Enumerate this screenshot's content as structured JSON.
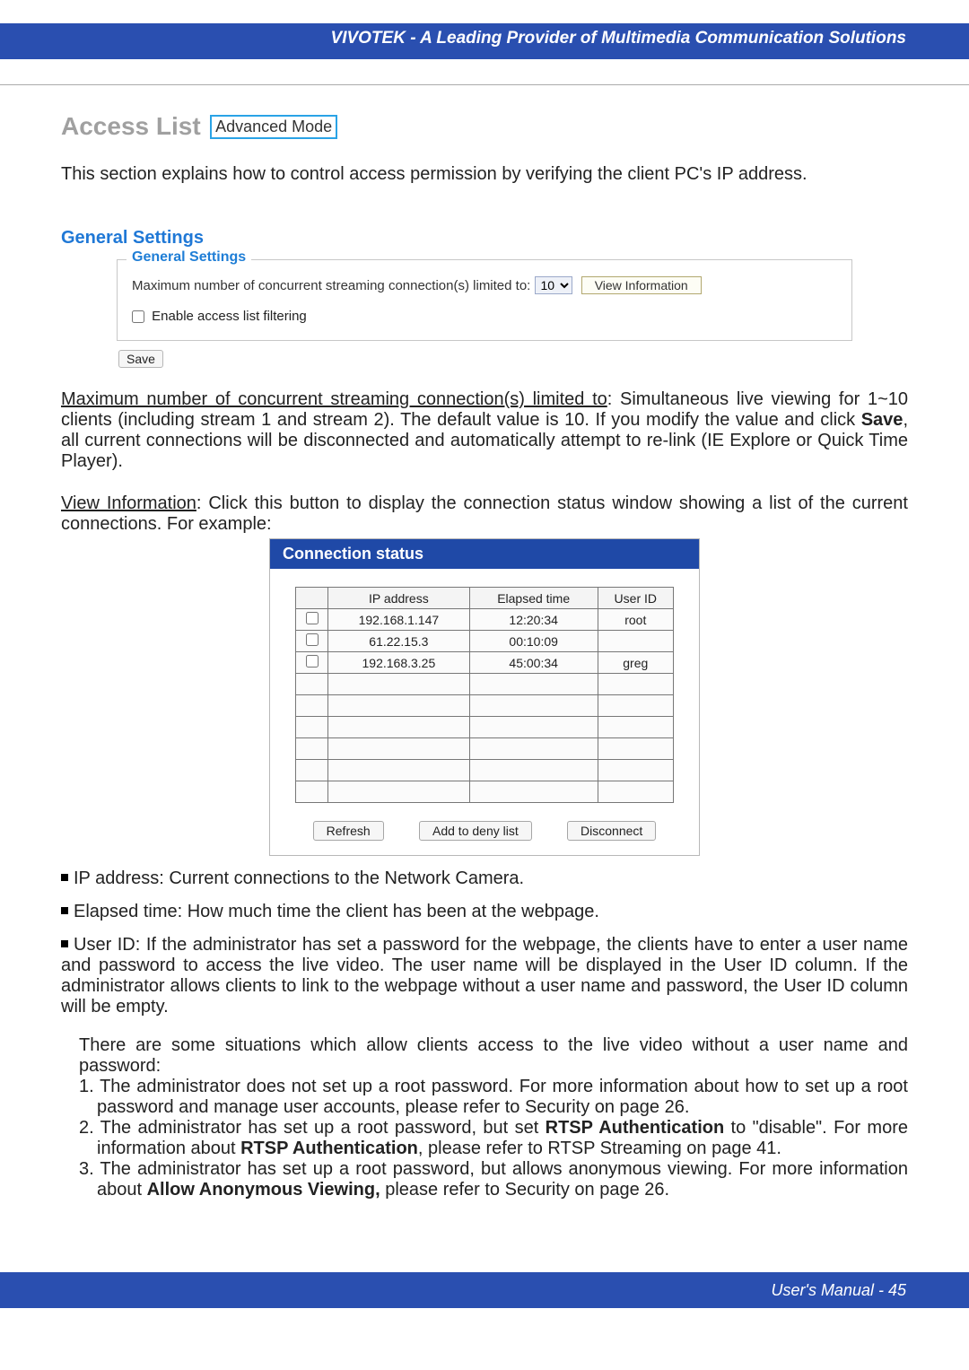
{
  "header": {
    "title": "VIVOTEK - A Leading Provider of Multimedia Communication Solutions"
  },
  "title": {
    "main": "Access List",
    "badge": "Advanced Mode"
  },
  "intro": "This section explains how to control access permission by verifying the client PC's IP address.",
  "gs_heading": "General Settings",
  "general_settings": {
    "legend": "General Settings",
    "max_label": "Maximum number of concurrent streaming connection(s) limited to:",
    "max_value": "10",
    "view_info_btn": "View Information",
    "enable_filter_label": "Enable access list filtering",
    "save_btn": "Save"
  },
  "para_max": {
    "lead": "Maximum number of concurrent streaming connection(s) limited to",
    "rest_a": ": Simultaneous live viewing for 1~10 clients (including stream 1 and stream 2). The default value is 10. If you modify the value and click ",
    "save_word": "Save",
    "rest_b": ", all current connections will be disconnected and automatically attempt to re-link (IE Explore or Quick Time Player)."
  },
  "para_view": {
    "lead": "View Information",
    "rest": ": Click this button to display the connection status window showing a list of the current connections. For example:"
  },
  "conn_status": {
    "title": "Connection status",
    "headers": [
      "",
      "IP address",
      "Elapsed time",
      "User ID"
    ],
    "rows": [
      {
        "ip": "192.168.1.147",
        "time": "12:20:34",
        "user": "root"
      },
      {
        "ip": "61.22.15.3",
        "time": "00:10:09",
        "user": ""
      },
      {
        "ip": "192.168.3.25",
        "time": "45:00:34",
        "user": "greg"
      }
    ],
    "empty_rows": 6,
    "buttons": {
      "refresh": "Refresh",
      "add": "Add to deny list",
      "disconnect": "Disconnect"
    }
  },
  "bullets": {
    "ip": "IP address: Current connections to the Network Camera.",
    "elapsed": "Elapsed time: How much time the client has been at the webpage.",
    "userid": "User ID: If the administrator has set a password for the webpage, the clients have to enter a user name and password to access the live video. The user name will be displayed in the User ID column. If  the administrator allows clients to link to the webpage without a user name and password, the User ID column will be empty."
  },
  "situations": {
    "intro": "There are some situations which allow clients access to the live video without a user name and password:",
    "s1a": "1. The administrator does not set up a root password. For more information about how to set up a root password and manage user accounts, please refer to Security on page 26.",
    "s2a": "2. The administrator has set up a root password, but set ",
    "s2b": "RTSP Authentication",
    "s2c": " to \"disable\". For more information about ",
    "s2d": "RTSP Authentication",
    "s2e": ", please refer to RTSP Streaming on page 41.",
    "s3a": "3. The administrator has set up a root password, but allows anonymous viewing. For more information about ",
    "s3b": "Allow Anonymous Viewing,",
    "s3c": " please refer to Security on page 26."
  },
  "footer": {
    "text": "User's Manual - 45"
  }
}
